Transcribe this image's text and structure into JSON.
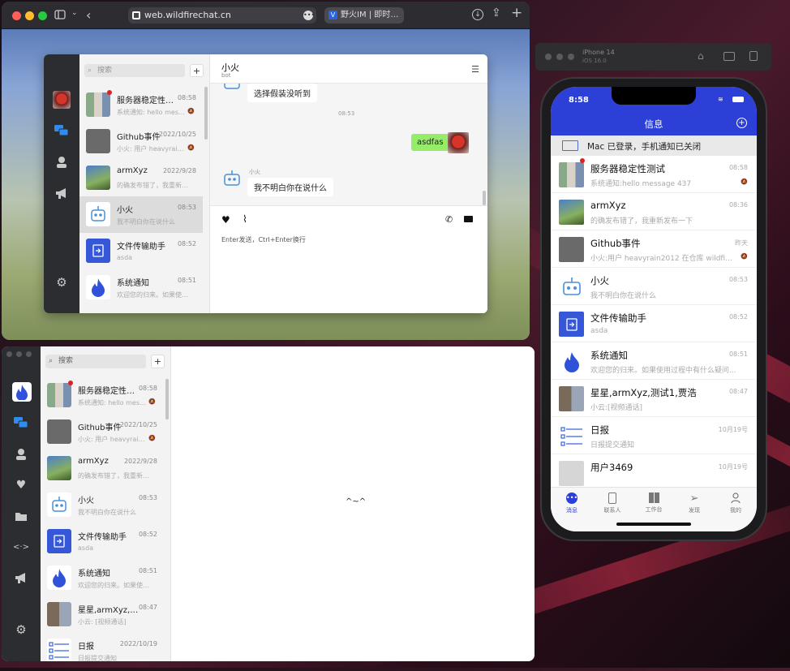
{
  "browser": {
    "url": "web.wildfirechat.cn",
    "tab_title": "野火IM | 即时通..."
  },
  "web": {
    "search_placeholder": "搜索",
    "add_label": "+",
    "chat_title": "小火",
    "chat_subtitle": "bot",
    "conversations": [
      {
        "name": "服务器稳定性测试",
        "time": "08:58",
        "msg": "系统通知: hello messa..."
      },
      {
        "name": "Github事件",
        "time": "2022/10/25",
        "msg": "小火: 用户 heavyrain2..."
      },
      {
        "name": "armXyz",
        "time": "2022/9/28",
        "msg": "的确发布错了，我重新..."
      },
      {
        "name": "小火",
        "time": "08:53",
        "msg": "我不明白你在说什么"
      },
      {
        "name": "文件传输助手",
        "time": "08:52",
        "msg": "asda"
      },
      {
        "name": "系统通知",
        "time": "08:51",
        "msg": "欢迎您的归来。如果使..."
      }
    ],
    "messages": {
      "m1": "选择假装没听到",
      "time": "08:53",
      "m2": "asdfas",
      "sender": "小火",
      "m3": "我不明白你在说什么"
    },
    "input_hint": "Enter发送，Ctrl+Enter换行"
  },
  "desktop": {
    "search_placeholder": "搜索",
    "add_label": "+",
    "empty_text": "^~^",
    "conversations": [
      {
        "name": "服务器稳定性测试",
        "time": "08:58",
        "msg": "系统通知: hello mess..."
      },
      {
        "name": "Github事件",
        "time": "2022/10/25",
        "msg": "小火: 用户 heavyrain..."
      },
      {
        "name": "armXyz",
        "time": "2022/9/28",
        "msg": "的确发布错了，我重新..."
      },
      {
        "name": "小火",
        "time": "08:53",
        "msg": "我不明白你在说什么"
      },
      {
        "name": "文件传输助手",
        "time": "08:52",
        "msg": "asda"
      },
      {
        "name": "系统通知",
        "time": "08:51",
        "msg": "欢迎您的归来。如果使..."
      },
      {
        "name": "星星,armXyz,测...",
        "time": "08:47",
        "msg": "小云: [视频通话]"
      },
      {
        "name": "日报",
        "time": "2022/10/19",
        "msg": "日报提交通知"
      }
    ]
  },
  "simulator": {
    "device": "iPhone 14",
    "os": "iOS 16.0"
  },
  "phone": {
    "status_time": "8:58",
    "title": "信息",
    "notice": "Mac 已登录，手机通知已关闭",
    "conversations": [
      {
        "name": "服务器稳定性测试",
        "time": "08:58",
        "msg": "系统通知:hello message 437"
      },
      {
        "name": "armXyz",
        "time": "08:36",
        "msg": "的确发布错了，我重新发布一下"
      },
      {
        "name": "Github事件",
        "time": "昨天",
        "msg": "小火:用户 heavyrain2012 在仓库 wildfirec..."
      },
      {
        "name": "小火",
        "time": "08:53",
        "msg": "我不明白你在说什么"
      },
      {
        "name": "文件传输助手",
        "time": "08:52",
        "msg": "asda"
      },
      {
        "name": "系统通知",
        "time": "08:51",
        "msg": "欢迎您的归来。如果使用过程中有什么疑问..."
      },
      {
        "name": "星星,armXyz,测试1,贾浩",
        "time": "08:47",
        "msg": "小云:[视频通话]"
      },
      {
        "name": "日报",
        "time": "10月19号",
        "msg": "日报提交通知"
      },
      {
        "name": "用户3469",
        "time": "10月19号",
        "msg": ""
      }
    ],
    "tabs": [
      "消息",
      "联系人",
      "工作台",
      "发现",
      "我的"
    ]
  },
  "colors": {
    "accent": "#2c3fd6",
    "bubble_green": "#95ec69",
    "red_dot": "#e02020"
  }
}
